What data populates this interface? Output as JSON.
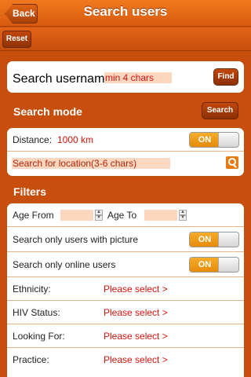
{
  "nav": {
    "title": "Search users",
    "back_label": "Back"
  },
  "toolbar": {
    "reset_label": "Reset"
  },
  "search_username": {
    "label": "Search username:",
    "placeholder": "min 4 chars",
    "find_label": "Find"
  },
  "search_mode": {
    "title": "Search mode",
    "search_label": "Search",
    "distance_label": "Distance:",
    "distance_value": "1000 km",
    "distance_toggle": "ON",
    "location_placeholder": "Search for location(3-6 chars)"
  },
  "filters": {
    "title": "Filters",
    "age_from_label": "Age From",
    "age_to_label": "Age To",
    "with_picture_label": "Search only users with picture",
    "with_picture_toggle": "ON",
    "online_label": "Search only online users",
    "online_toggle": "ON",
    "selects": [
      {
        "label": "Ethnicity:",
        "value": "Please select >"
      },
      {
        "label": "HIV Status:",
        "value": "Please select >"
      },
      {
        "label": "Looking For:",
        "value": "Please select >"
      },
      {
        "label": "Practice:",
        "value": "Please select >"
      }
    ]
  }
}
